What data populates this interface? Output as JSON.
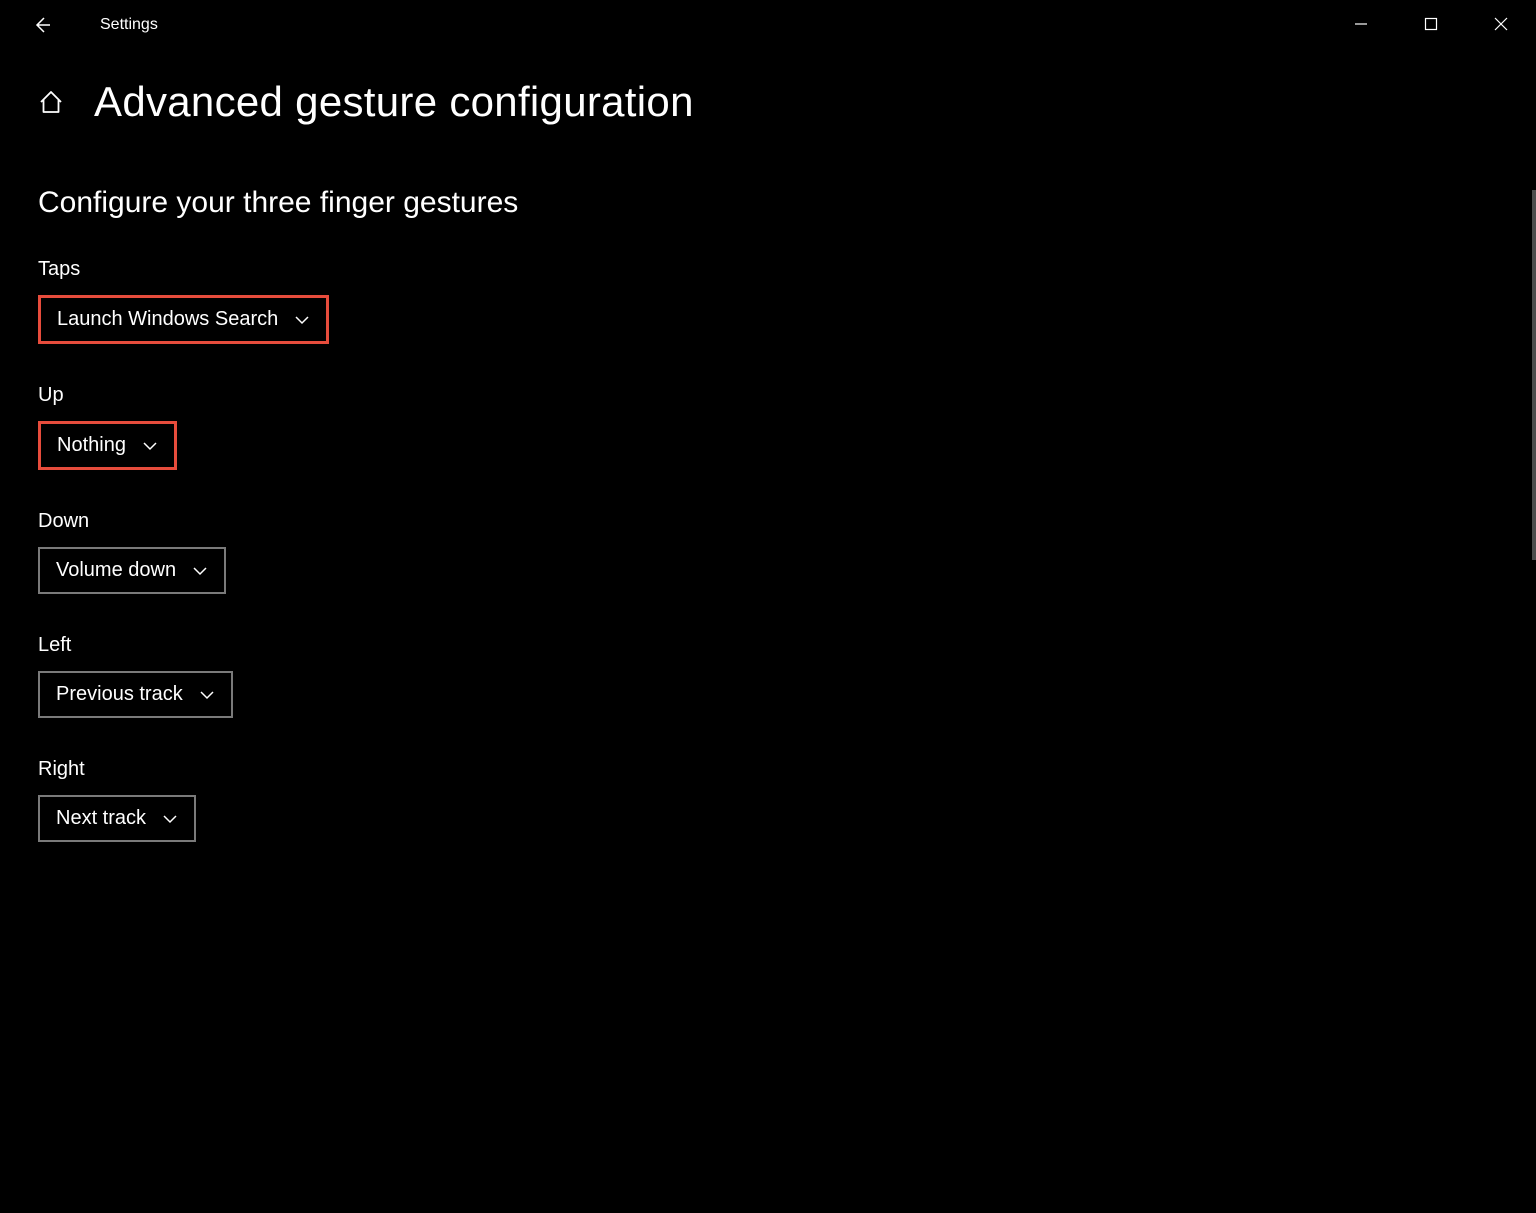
{
  "app": {
    "title": "Settings"
  },
  "page": {
    "title": "Advanced gesture configuration"
  },
  "section": {
    "title": "Configure your three finger gestures"
  },
  "gestures": {
    "taps": {
      "label": "Taps",
      "value": "Launch Windows Search",
      "highlighted": true
    },
    "up": {
      "label": "Up",
      "value": "Nothing",
      "highlighted": true
    },
    "down": {
      "label": "Down",
      "value": "Volume down",
      "highlighted": false
    },
    "left": {
      "label": "Left",
      "value": "Previous track",
      "highlighted": false
    },
    "right": {
      "label": "Right",
      "value": "Next track",
      "highlighted": false
    }
  }
}
